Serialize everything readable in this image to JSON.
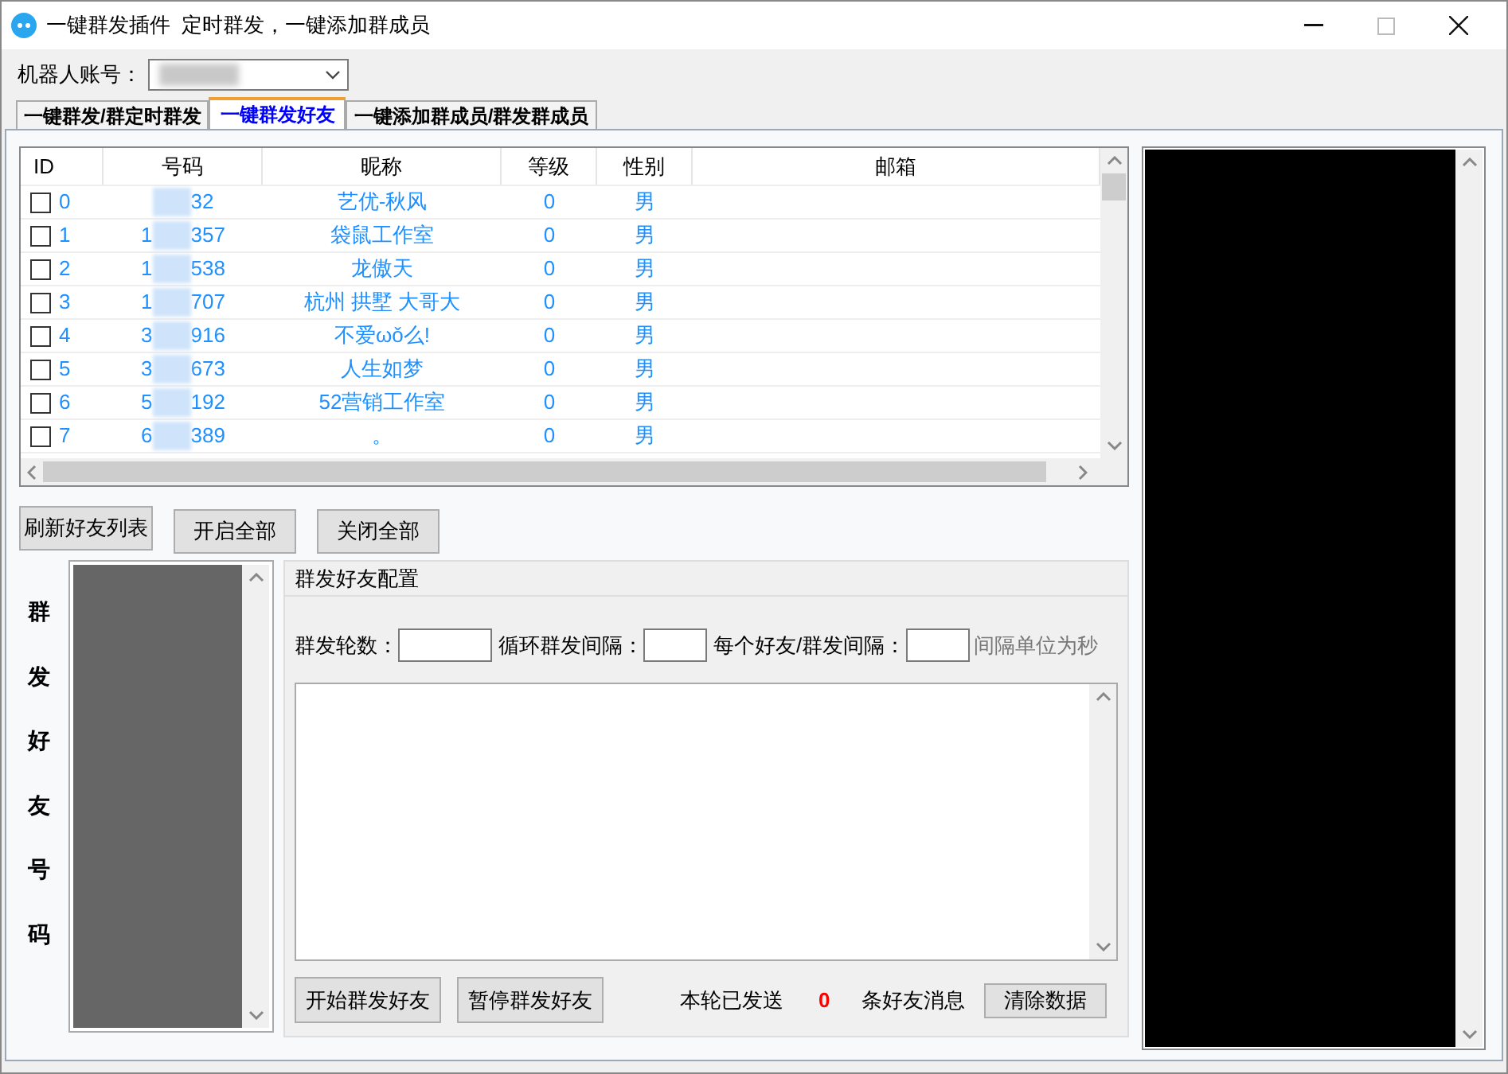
{
  "window": {
    "title": "一键群发插件  定时群发，一键添加群成员"
  },
  "account": {
    "label": "机器人账号："
  },
  "tabs": [
    {
      "label": "一键群发/群定时群发",
      "selected": false
    },
    {
      "label": "一键群发好友",
      "selected": true
    },
    {
      "label": "一键添加群成员/群发群成员",
      "selected": false
    }
  ],
  "table": {
    "columns": [
      "ID",
      "号码",
      "昵称",
      "等级",
      "性别",
      "邮箱"
    ],
    "rows": [
      {
        "checked": false,
        "id": "0",
        "qq_head": "",
        "qq_tail": "32",
        "nickname": "艺优-秋风",
        "level": "0",
        "gender": "男"
      },
      {
        "checked": false,
        "id": "1",
        "qq_head": "1",
        "qq_tail": "357",
        "nickname": "袋鼠工作室",
        "level": "0",
        "gender": "男"
      },
      {
        "checked": false,
        "id": "2",
        "qq_head": "1",
        "qq_tail": "538",
        "nickname": "龙傲天",
        "level": "0",
        "gender": "男"
      },
      {
        "checked": false,
        "id": "3",
        "qq_head": "1",
        "qq_tail": "707",
        "nickname": "杭州 拱墅 大哥大",
        "level": "0",
        "gender": "男"
      },
      {
        "checked": false,
        "id": "4",
        "qq_head": "3",
        "qq_tail": "916",
        "nickname": "不爱ωǒ么!",
        "level": "0",
        "gender": "男"
      },
      {
        "checked": false,
        "id": "5",
        "qq_head": "3",
        "qq_tail": "673",
        "nickname": "人生如梦",
        "level": "0",
        "gender": "男"
      },
      {
        "checked": false,
        "id": "6",
        "qq_head": "5",
        "qq_tail": "192",
        "nickname": "52营销工作室",
        "level": "0",
        "gender": "男"
      },
      {
        "checked": false,
        "id": "7",
        "qq_head": "6",
        "qq_tail": "389",
        "nickname": "。",
        "level": "0",
        "gender": "男"
      }
    ]
  },
  "buttons": [
    "刷新好友列表",
    "开启全部",
    "关闭全部"
  ],
  "side_label": "群发好友号码",
  "config": {
    "title": "群发好友配置",
    "fields": [
      {
        "label": "群发轮数："
      },
      {
        "label": "循环群发间隔："
      },
      {
        "label": "每个好友/群发间隔："
      }
    ],
    "unit_note": "间隔单位为秒",
    "actions": [
      "开始群发好友",
      "暂停群发好友"
    ],
    "sent_label": "本轮已发送",
    "sent_count": "0",
    "sent_suffix": "条好友消息",
    "clear_button": "清除数据"
  }
}
